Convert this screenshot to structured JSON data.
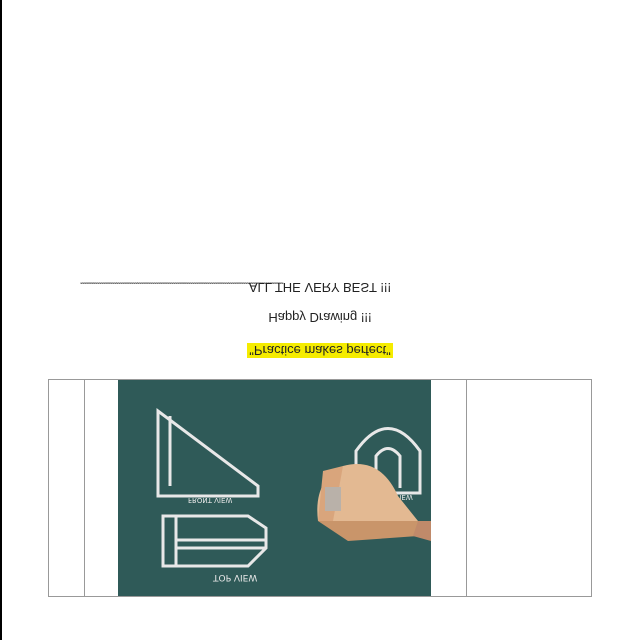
{
  "document": {
    "divider": "************************************************************************************************",
    "closing_line": "ALL THE VERY BEST !!!",
    "greeting": "Happy Drawing !!!",
    "quote": "\"Practice makes perfect\""
  },
  "photo": {
    "labels": {
      "top_view": "TOP VIEW",
      "front_view": "FRONT VIEW",
      "side_view": "SIDE VIEW"
    },
    "colors": {
      "board": "#2f5a58",
      "chalk": "#e8e8e8",
      "model": "#e3b992"
    }
  }
}
